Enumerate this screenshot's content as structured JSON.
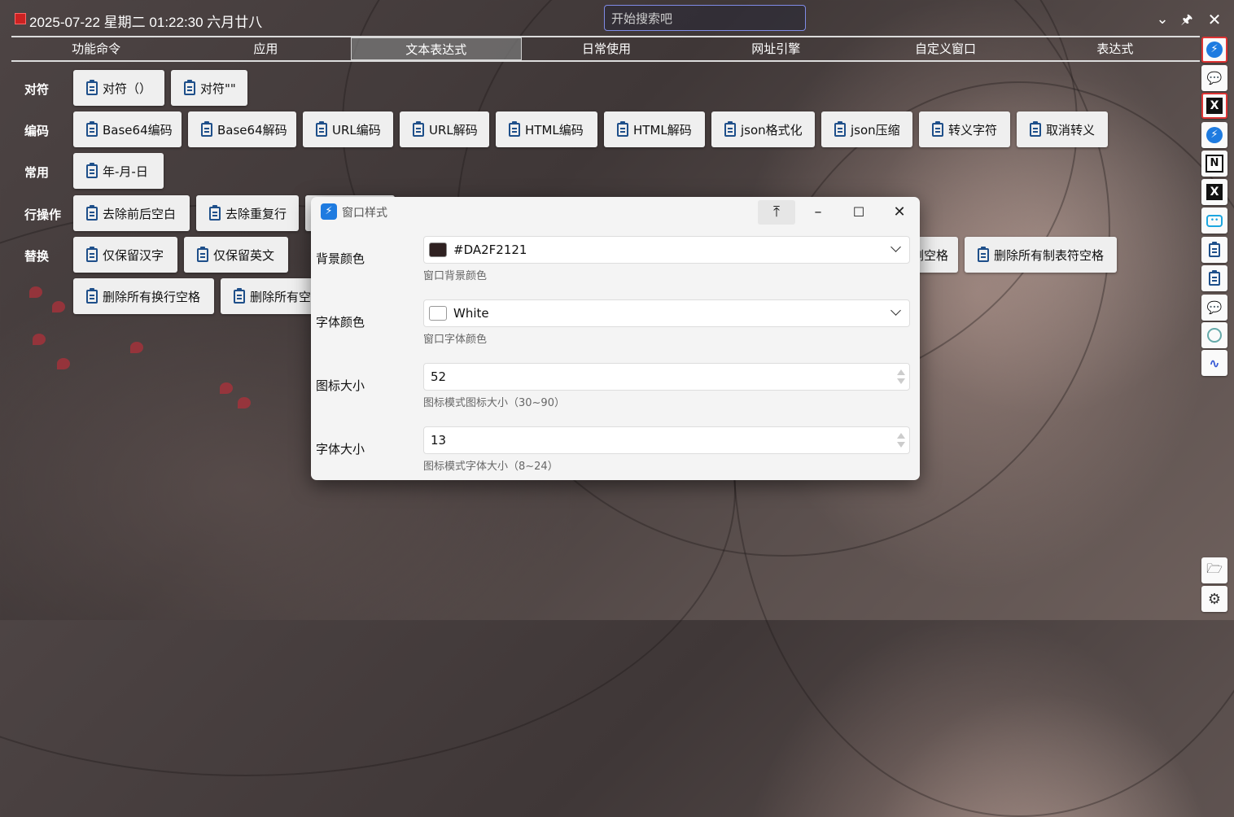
{
  "titlebar": {
    "datetime": "2025-07-22 星期二 01:22:30 六月廿八",
    "search_placeholder": "开始搜索吧",
    "collapse_icon": "chevron-down-icon",
    "pin_icon": "pin-icon",
    "close_icon": "close-icon"
  },
  "tabs": [
    "功能命令",
    "应用",
    "文本表达式",
    "日常使用",
    "网址引擎",
    "自定义窗口",
    "表达式"
  ],
  "active_tab": "文本表达式",
  "rows": {
    "pair_label": "对符",
    "pair_items": [
      "对符（）",
      "对符\"\""
    ],
    "encode_label": "编码",
    "encode_items": [
      "Base64编码",
      "Base64解码",
      "URL编码",
      "URL解码",
      "HTML编码",
      "HTML解码",
      "json格式化",
      "json压缩",
      "转义字符",
      "取消转义"
    ],
    "common_label": "常用",
    "common_items": [
      "年-月-日"
    ],
    "line_label": "行操作",
    "line_items": [
      "去除前后空白",
      "去除重复行"
    ],
    "replace_label": "替换",
    "replace_items": [
      "仅保留汉字",
      "仅保留英文",
      "删空格",
      "删除所有制表符空格"
    ],
    "replace_items_row2": [
      "删除所有换行空格",
      "删除所有空"
    ]
  },
  "dialog": {
    "title": "窗口样式",
    "fields": {
      "bg_label": "背景颜色",
      "bg_value": "#DA2F2121",
      "bg_hint": "窗口背景颜色",
      "font_color_label": "字体颜色",
      "font_color_value": "White",
      "font_color_hint": "窗口字体颜色",
      "icon_size_label": "图标大小",
      "icon_size_value": "52",
      "icon_size_hint": "图标模式图标大小（30~90）",
      "font_size_label": "字体大小",
      "font_size_value": "13",
      "font_size_hint": "图标模式字体大小（8~24）"
    }
  },
  "sidebar_icons": [
    "lightning-icon",
    "chat-icon",
    "x-logo-icon",
    "lightning-icon",
    "notion-icon",
    "x-logo-icon",
    "bilibili-icon",
    "clipboard-icon",
    "clipboard-icon",
    "translate-icon",
    "chatgpt-icon",
    "deepseek-icon",
    "folder-icon",
    "settings-icon"
  ],
  "colors": {
    "bg_swatch": "#2F2121",
    "font_swatch": "#FFFFFF",
    "accent": "#1E7BE0"
  }
}
